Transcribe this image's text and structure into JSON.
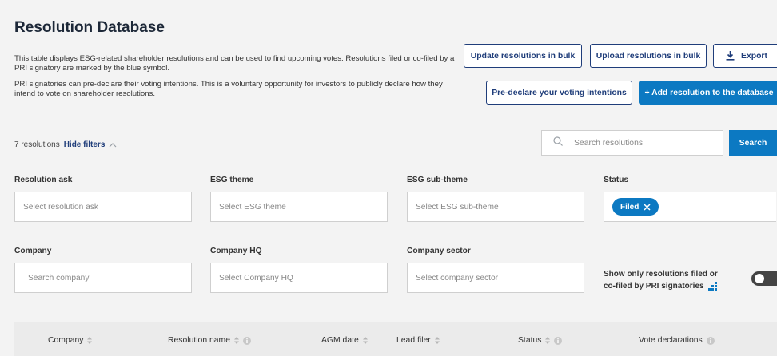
{
  "header": {
    "title": "Resolution Database",
    "description_1": "This table displays ESG-related shareholder resolutions and can be used to find upcoming votes. Resolutions filed or co-filed by a PRI signatory are marked by the blue symbol.",
    "description_2": "PRI signatories can pre-declare their voting intentions. This is a voluntary opportunity for investors to publicly declare how they intend to vote on shareholder resolutions."
  },
  "actions": {
    "update_bulk": "Update resolutions in bulk",
    "upload_bulk": "Upload resolutions in bulk",
    "export": "Export",
    "predeclare": "Pre-declare your voting intentions",
    "add_resolution": "+ Add resolution to the database"
  },
  "results": {
    "count_text": "7 resolutions",
    "hide_filters": "Hide filters"
  },
  "search": {
    "placeholder": "Search resolutions",
    "button": "Search"
  },
  "filters": {
    "resolution_ask": {
      "label": "Resolution ask",
      "placeholder": "Select resolution ask"
    },
    "esg_theme": {
      "label": "ESG theme",
      "placeholder": "Select ESG theme"
    },
    "esg_subtheme": {
      "label": "ESG sub-theme",
      "placeholder": "Select ESG sub-theme"
    },
    "status": {
      "label": "Status",
      "selected": "Filed"
    },
    "company": {
      "label": "Company",
      "placeholder": "Search company"
    },
    "company_hq": {
      "label": "Company HQ",
      "placeholder": "Select Company HQ"
    },
    "company_sector": {
      "label": "Company sector",
      "placeholder": "Select company sector"
    },
    "pri_toggle": {
      "label_line1": "Show only resolutions filed or",
      "label_line2": "co-filed by PRI signatories",
      "enabled": false
    }
  },
  "table": {
    "columns": [
      "Company",
      "Resolution name",
      "AGM date",
      "Lead filer",
      "Status",
      "Vote declarations"
    ]
  },
  "colors": {
    "primary": "#0c79c2",
    "navy": "#1f3d7a",
    "background": "#f3f3f3"
  }
}
